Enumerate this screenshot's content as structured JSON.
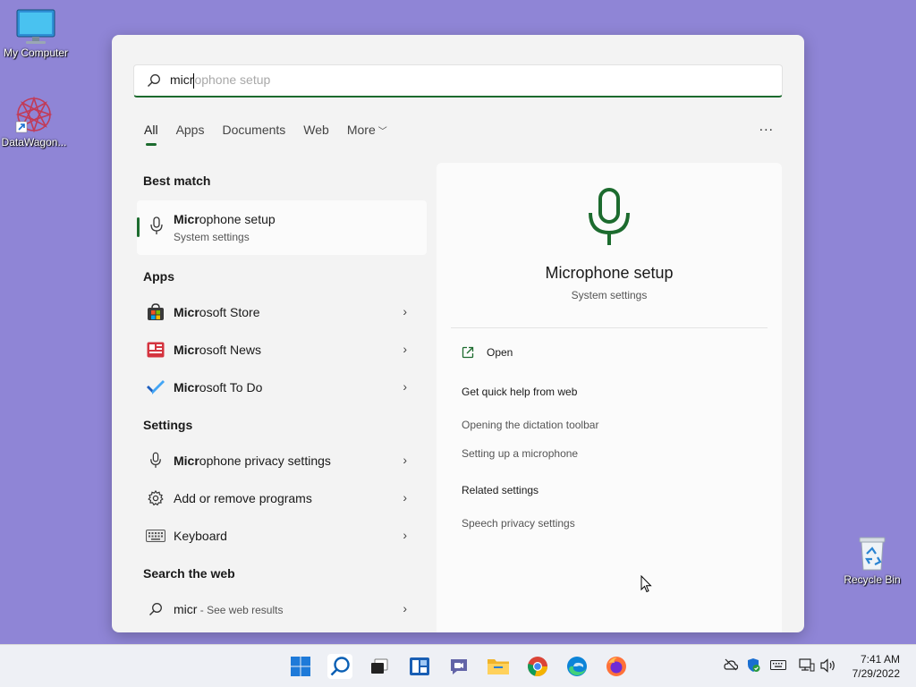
{
  "desktop": {
    "icons": [
      {
        "label": "My Computer"
      },
      {
        "label": "DataWagon..."
      },
      {
        "label": "Recycle Bin"
      }
    ]
  },
  "search": {
    "typed": "micr",
    "suggestion": "ophone setup"
  },
  "tabs": [
    {
      "label": "All",
      "active": true
    },
    {
      "label": "Apps"
    },
    {
      "label": "Documents"
    },
    {
      "label": "Web"
    },
    {
      "label": "More"
    }
  ],
  "more_options": "...",
  "best_match": {
    "heading": "Best match",
    "title_bold": "Micr",
    "title_rest": "ophone setup",
    "subtitle": "System settings"
  },
  "apps": {
    "heading": "Apps",
    "items": [
      {
        "bold": "Micr",
        "rest": "osoft Store",
        "icon": "microsoft-store-icon"
      },
      {
        "bold": "Micr",
        "rest": "osoft News",
        "icon": "microsoft-news-icon"
      },
      {
        "bold": "Micr",
        "rest": "osoft To Do",
        "icon": "microsoft-todo-icon"
      }
    ]
  },
  "settings": {
    "heading": "Settings",
    "items": [
      {
        "bold": "Micr",
        "rest": "ophone privacy settings",
        "icon": "microphone-icon"
      },
      {
        "bold": "",
        "rest": "Add or remove programs",
        "icon": "gear-icon"
      },
      {
        "bold": "",
        "rest": "Keyboard",
        "icon": "keyboard-icon"
      }
    ]
  },
  "web": {
    "heading": "Search the web",
    "query": "micr",
    "suffix": " - See web results"
  },
  "preview": {
    "title": "Microphone setup",
    "subtitle": "System settings",
    "open_label": "Open",
    "quick_help_heading": "Get quick help from web",
    "help_links": [
      "Opening the dictation toolbar",
      "Setting up a microphone"
    ],
    "related_heading": "Related settings",
    "related_links": [
      "Speech privacy settings"
    ],
    "accent_color": "#1c6b2e"
  },
  "taskbar": {
    "time": "7:41 AM",
    "date": "7/29/2022"
  }
}
